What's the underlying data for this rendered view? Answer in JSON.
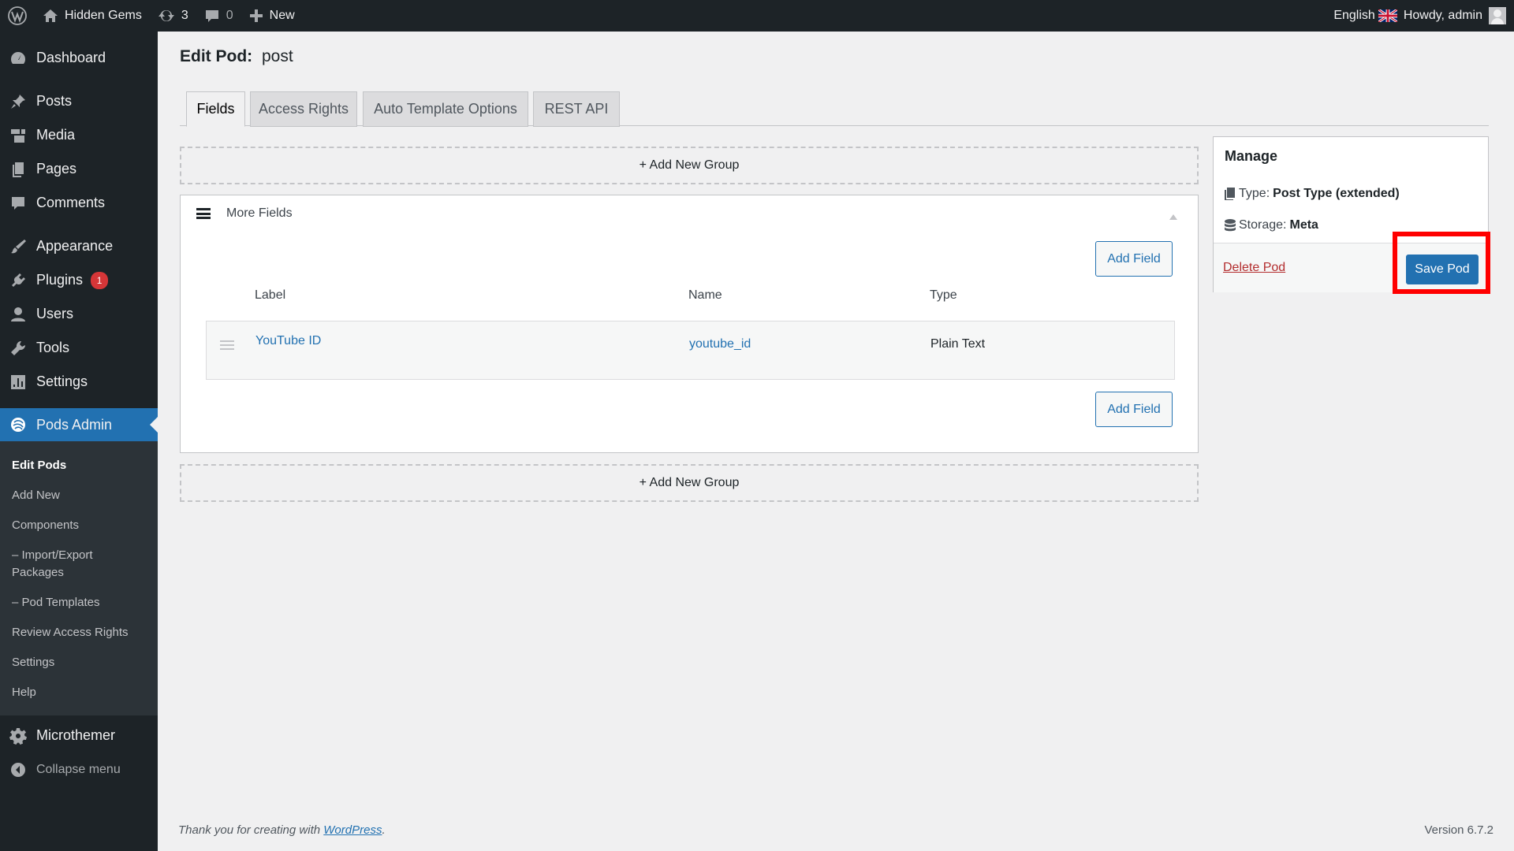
{
  "adminbar": {
    "site_name": "Hidden Gems",
    "updates_count": "3",
    "comments_count": "0",
    "new_label": "New",
    "language": "English",
    "howdy": "Howdy, admin"
  },
  "sidebar": {
    "items": [
      {
        "label": "Dashboard",
        "icon": "dashboard-icon"
      },
      {
        "label": "Posts",
        "icon": "pin-icon"
      },
      {
        "label": "Media",
        "icon": "media-icon"
      },
      {
        "label": "Pages",
        "icon": "pages-icon"
      },
      {
        "label": "Comments",
        "icon": "comment-icon"
      },
      {
        "label": "Appearance",
        "icon": "brush-icon"
      },
      {
        "label": "Plugins",
        "icon": "plugin-icon",
        "badge": "1"
      },
      {
        "label": "Users",
        "icon": "user-icon"
      },
      {
        "label": "Tools",
        "icon": "wrench-icon"
      },
      {
        "label": "Settings",
        "icon": "settings-icon"
      },
      {
        "label": "Pods Admin",
        "icon": "pods-icon"
      },
      {
        "label": "Microthemer",
        "icon": "gear-icon"
      }
    ],
    "submenu": [
      "Edit Pods",
      "Add New",
      "Components",
      "– Import/Export Packages",
      "– Pod Templates",
      "Review Access Rights",
      "Settings",
      "Help"
    ],
    "collapse_label": "Collapse menu"
  },
  "page": {
    "title_prefix": "Edit Pod:",
    "title_name": "post"
  },
  "tabs": [
    "Fields",
    "Access Rights",
    "Auto Template Options",
    "REST API"
  ],
  "add_group_label": "+ Add New Group",
  "group": {
    "title": "More Fields",
    "add_field_label": "Add Field",
    "columns": [
      "Label",
      "Name",
      "Type"
    ],
    "fields": [
      {
        "label": "YouTube ID",
        "name": "youtube_id",
        "type": "Plain Text"
      }
    ]
  },
  "manage": {
    "title": "Manage",
    "type_label": "Type:",
    "type_value": "Post Type (extended)",
    "storage_label": "Storage:",
    "storage_value": "Meta",
    "delete_label": "Delete Pod",
    "save_label": "Save Pod"
  },
  "footer": {
    "thanks_prefix": "Thank you for creating with",
    "thanks_link": "WordPress",
    "thanks_suffix": ".",
    "version": "Version 6.7.2"
  },
  "colors": {
    "accent": "#2271b1",
    "admin_bg": "#1d2327",
    "highlight": "#ff0000",
    "danger": "#b32d2e"
  }
}
